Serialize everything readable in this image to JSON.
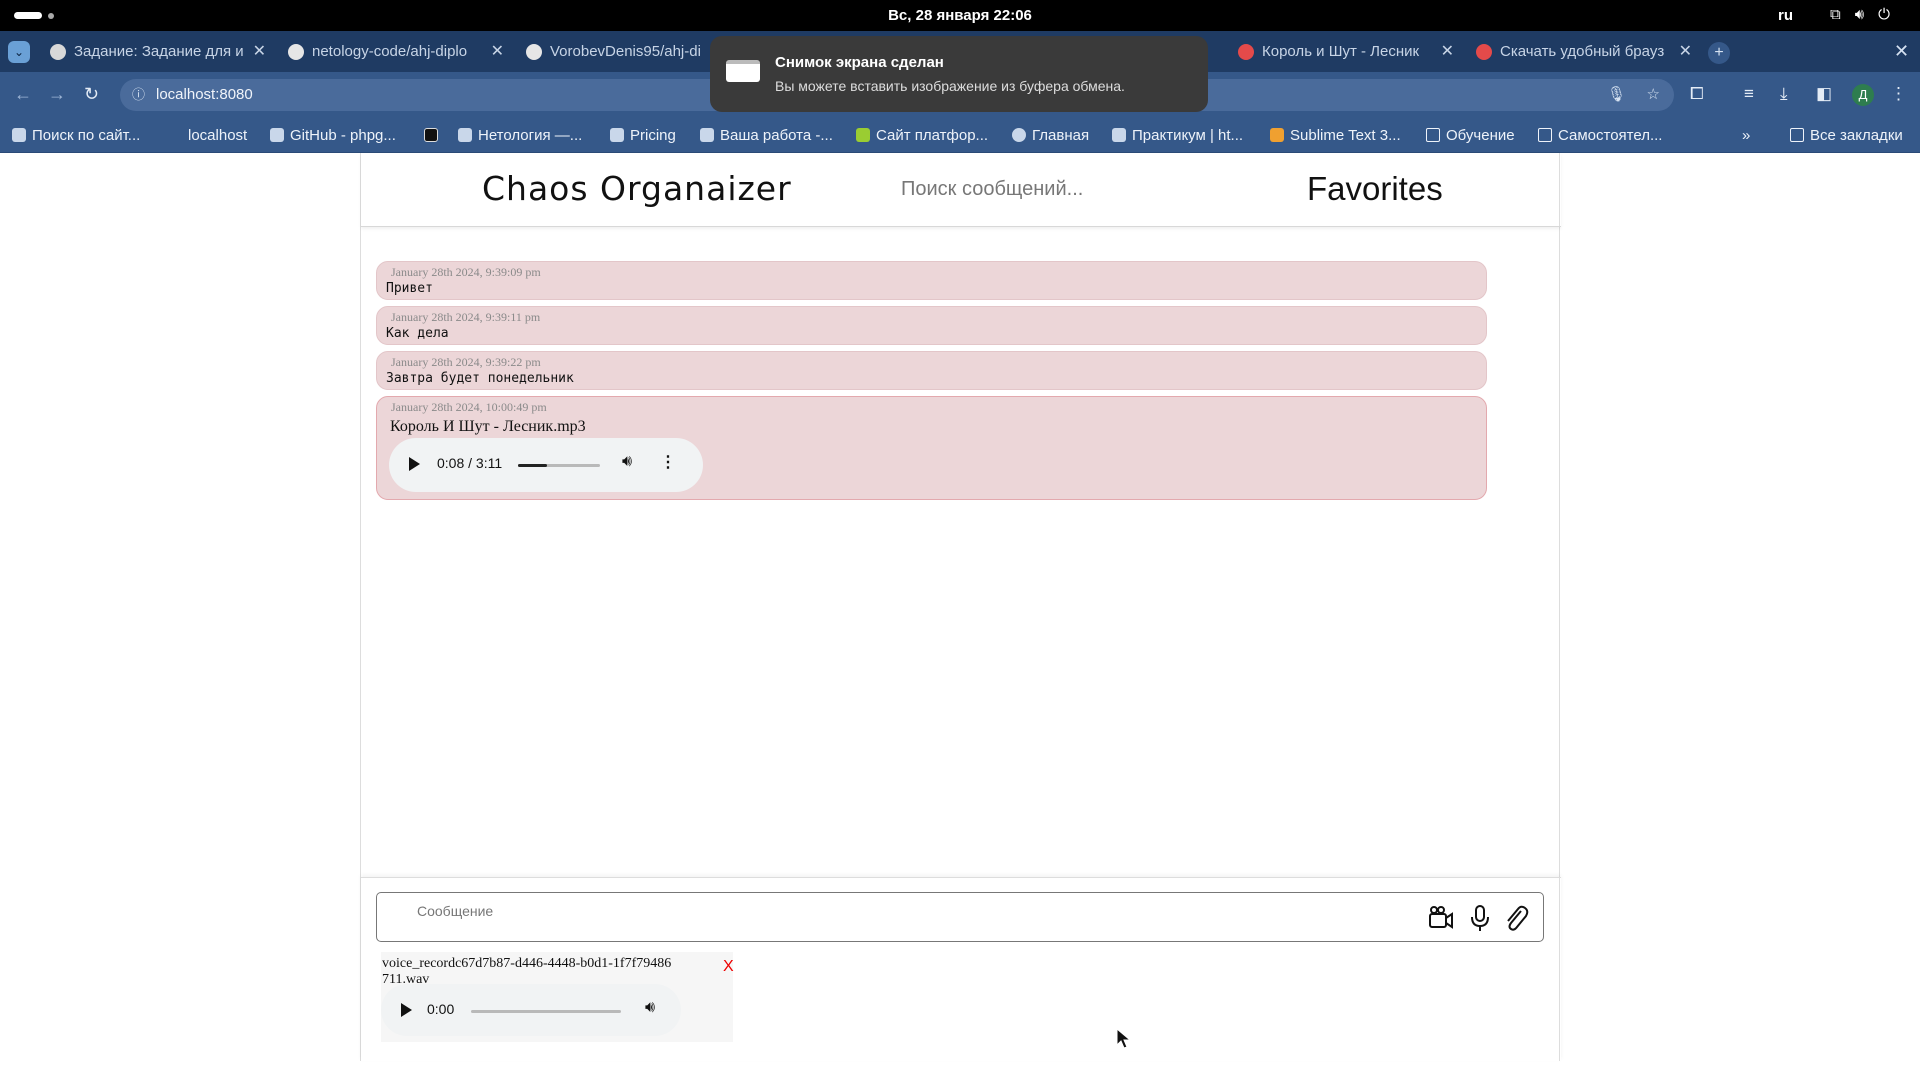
{
  "system": {
    "clock": "Вс, 28 января  22:06",
    "lang": "ru"
  },
  "browser": {
    "tabs": [
      {
        "title": "Задание: Задание для и",
        "active": false
      },
      {
        "title": "netology-code/ahj-diplo",
        "active": false
      },
      {
        "title": "VorobevDenis95/ahj-di",
        "active": false
      },
      {
        "title": "Король и Шут - Лесник",
        "active": false
      },
      {
        "title": "Скачать удобный брауз",
        "active": false
      }
    ],
    "url": "localhost:8080",
    "profile_initial": "Д",
    "bookmarks": [
      "Поиск по сайт...",
      "localhost",
      "GitHub - phpg...",
      "",
      "Нетология —...",
      "Pricing",
      "Ваша работа -...",
      "Сайт платфор...",
      "Главная",
      "Практикум | ht...",
      "Sublime Text 3...",
      "Обучение",
      "Самостоятел...",
      "Все закладки"
    ]
  },
  "notification": {
    "title": "Снимок экрана сделан",
    "body": "Вы можете вставить изображение из буфера обмена."
  },
  "app": {
    "title": "Chaos Organaizer",
    "search_placeholder": "Поиск сообщений...",
    "favorites_label": "Favorites",
    "messages": [
      {
        "date": "January 28th 2024, 9:39:09 pm",
        "text": "Привет"
      },
      {
        "date": "January 28th 2024, 9:39:11 pm",
        "text": "Как дела"
      },
      {
        "date": "January 28th 2024, 9:39:22 pm",
        "text": "Завтра будет понедельник"
      }
    ],
    "audio_message": {
      "date": "January 28th 2024, 10:00:49 pm",
      "file_name": "Король И Шут - Лесник.mp3",
      "time": "0:08 / 3:11",
      "progress": 0.04
    },
    "composer": {
      "placeholder": "Сообщение",
      "icons": [
        "video-camera-icon",
        "microphone-icon",
        "paperclip-icon"
      ]
    },
    "attachment": {
      "file_name": "voice_recordc67d7b87-d446-4448-b0d1-1f7f79486711.wav",
      "remove_label": "X",
      "time": "0:00",
      "progress": 0
    }
  }
}
